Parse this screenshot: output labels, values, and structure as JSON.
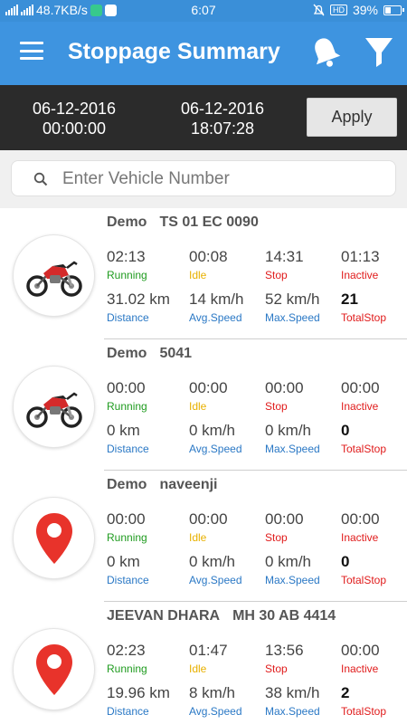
{
  "status_bar": {
    "network_speed": "48.7KB/s",
    "time": "6:07",
    "battery": "39%",
    "hd_label": "HD",
    "icons": [
      "signal-icon",
      "chat-icon",
      "download-icon",
      "mute-icon",
      "battery-icon"
    ]
  },
  "app_bar": {
    "title": "Stoppage Summary",
    "color": "#3e94e0",
    "icons": [
      "menu-icon",
      "bell-icon",
      "filter-icon"
    ]
  },
  "date_range": {
    "from_date": "06-12-2016",
    "from_time": "00:00:00",
    "to_date": "06-12-2016",
    "to_time": "18:07:28",
    "apply_label": "Apply"
  },
  "search": {
    "placeholder": "Enter Vehicle Number",
    "value": ""
  },
  "labels": {
    "running": "Running",
    "idle": "Idle",
    "stop": "Stop",
    "inactive": "Inactive",
    "distance": "Distance",
    "avg_speed": "Avg.Speed",
    "max_speed": "Max.Speed",
    "total_stop": "TotalStop"
  },
  "status_colors": {
    "running": "#1f9b1f",
    "idle": "#e8b100",
    "stop": "#e01b1b",
    "inactive": "#e01b1b",
    "metric": "#2a78c5"
  },
  "vehicles": [
    {
      "name": "Demo",
      "number": "TS 01 EC 0090",
      "icon": "motorbike-icon",
      "running": "02:13",
      "idle": "00:08",
      "stop": "14:31",
      "inactive": "01:13",
      "distance": "31.02 km",
      "avg_speed": "14 km/h",
      "max_speed": "52 km/h",
      "total_stop": "21"
    },
    {
      "name": "Demo",
      "number": "5041",
      "icon": "motorbike-icon",
      "running": "00:00",
      "idle": "00:00",
      "stop": "00:00",
      "inactive": "00:00",
      "distance": "0 km",
      "avg_speed": "0 km/h",
      "max_speed": "0 km/h",
      "total_stop": "0"
    },
    {
      "name": "Demo",
      "number": "naveenji",
      "icon": "location-pin-icon",
      "running": "00:00",
      "idle": "00:00",
      "stop": "00:00",
      "inactive": "00:00",
      "distance": "0 km",
      "avg_speed": "0 km/h",
      "max_speed": "0 km/h",
      "total_stop": "0"
    },
    {
      "name": "JEEVAN DHARA",
      "number": "MH 30 AB 4414",
      "icon": "location-pin-icon",
      "running": "02:23",
      "idle": "01:47",
      "stop": "13:56",
      "inactive": "00:00",
      "distance": "19.96 km",
      "avg_speed": "8 km/h",
      "max_speed": "38 km/h",
      "total_stop": "2"
    }
  ]
}
